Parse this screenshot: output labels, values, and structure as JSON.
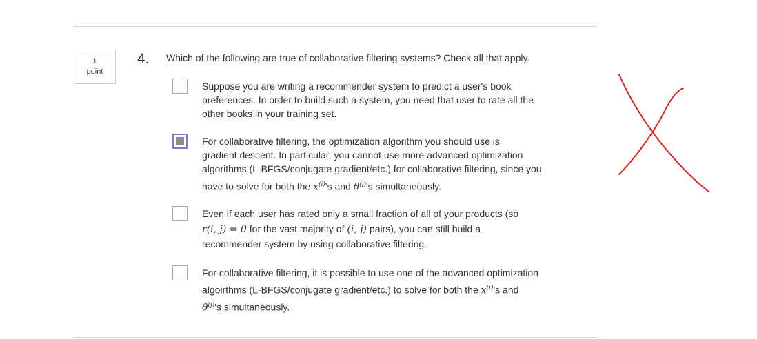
{
  "grading": {
    "points_value": "1",
    "points_unit": "point"
  },
  "question": {
    "number": "4.",
    "prompt": "Which of the following are true of collaborative filtering systems? Check all that apply."
  },
  "options": [
    {
      "checked": false,
      "lines": [
        "Suppose you are writing a recommender system to predict a user's book",
        "preferences. In order to build such a system, you need that user to rate all the",
        "other books in your training set."
      ]
    },
    {
      "checked": true,
      "lines": [
        "For collaborative filtering, the optimization algorithm you should use is",
        "gradient descent. In particular, you cannot use more advanced optimization",
        "algorithms (L-BFGS/conjugate gradient/etc.) for collaborative filtering, since you"
      ],
      "math_line": {
        "pre": "have to solve for both the ",
        "x": "x",
        "x_sup": "(i)",
        "mid": "'s and ",
        "theta": "θ",
        "theta_sup": "(j)",
        "post": "'s simultaneously."
      }
    },
    {
      "checked": false,
      "line1": "Even if each user has rated only a small fraction of all of your products (so",
      "math_line": {
        "r": "r(i, j) = 0",
        "mid": " for the vast majority of ",
        "pair": "(i, j)",
        "post": " pairs), you can still build a"
      },
      "line3": "recommender system by using collaborative filtering."
    },
    {
      "checked": false,
      "line1": "For collaborative filtering, it is possible to use one of the advanced optimization",
      "math_line": {
        "pre": "algoirthms (L-BFGS/conjugate gradient/etc.) to solve for both the ",
        "x": "x",
        "x_sup": "(i)",
        "post": "'s and"
      },
      "math_line2": {
        "theta": "θ",
        "theta_sup": "(j)",
        "post": "'s simultaneously."
      }
    }
  ],
  "annotation": {
    "mark": "incorrect-x",
    "color": "#e02020"
  }
}
